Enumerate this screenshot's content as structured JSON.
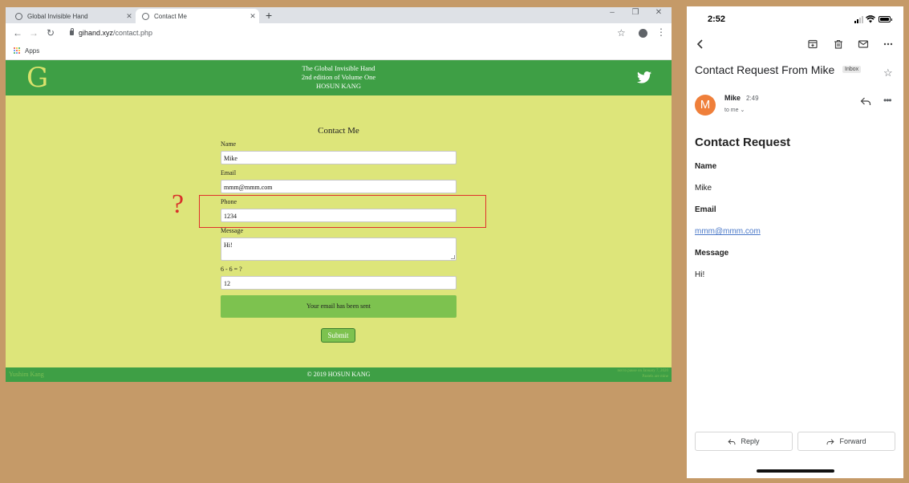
{
  "browser": {
    "tabs": [
      {
        "title": "Global Invisible Hand",
        "active": false
      },
      {
        "title": "Contact Me",
        "active": true
      }
    ],
    "url_host": "gihand.xyz",
    "url_path": "/contact.php",
    "bookmarks": {
      "apps_label": "Apps"
    }
  },
  "site": {
    "logo": "G",
    "header_lines": [
      "The Global Invisible Hand",
      "2nd edition of Volume One",
      "HOSUN KANG"
    ],
    "form": {
      "title": "Contact Me",
      "name_label": "Name",
      "name_value": "Mike",
      "email_label": "Email",
      "email_value": "mmm@mmm.com",
      "phone_label": "Phone",
      "phone_value": "1234",
      "message_label": "Message",
      "message_value": "Hi!",
      "captcha_label": "6 - 6 = ?",
      "captcha_value": "12",
      "status_message": "Your email has been sent",
      "submit_label": "Submit"
    },
    "annotation_mark": "?",
    "footer": {
      "left": "Yushim Kang",
      "center": "© 2019 HOSUN KANG",
      "right_line1": "not to pause on January 7, 2020",
      "right_line2": "Pastels are mine"
    }
  },
  "phone": {
    "status_time": "2:52",
    "email": {
      "subject": "Contact Request From Mike",
      "folder_badge": "Inbox",
      "avatar_letter": "M",
      "sender": "Mike",
      "time": "2:49",
      "recipient": "to me",
      "body_heading": "Contact Request",
      "fields": [
        {
          "label": "Name",
          "value": "Mike"
        },
        {
          "label": "Email",
          "value": "mmm@mmm.com"
        },
        {
          "label": "Message",
          "value": "Hi!"
        }
      ],
      "reply_label": "Reply",
      "forward_label": "Forward"
    }
  },
  "colors": {
    "site_header": "#3e9f45",
    "site_background": "#dde57a",
    "button_green": "#7dc24f",
    "highlight_red": "#e0302c",
    "avatar_orange": "#ef7f3a",
    "link_blue": "#4a78c8"
  }
}
